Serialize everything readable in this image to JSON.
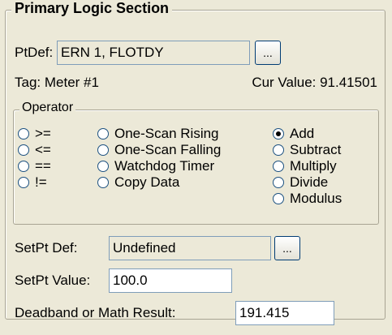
{
  "section": {
    "title": "Primary Logic Section"
  },
  "ptdef": {
    "label": "PtDef:",
    "value": "ERN 1, FLOTDY",
    "browse_label": "..."
  },
  "tag": {
    "label": "Tag: Meter #1",
    "cur_value": "Cur Value: 91.41501"
  },
  "operator": {
    "title": "Operator",
    "comparisons": [
      {
        "label": ">=",
        "selected": false
      },
      {
        "label": "<=",
        "selected": false
      },
      {
        "label": "==",
        "selected": false
      },
      {
        "label": "!=",
        "selected": false
      }
    ],
    "functions": [
      {
        "label": "One-Scan Rising",
        "selected": false
      },
      {
        "label": "One-Scan Falling",
        "selected": false
      },
      {
        "label": "Watchdog Timer",
        "selected": false
      },
      {
        "label": "Copy Data",
        "selected": false
      }
    ],
    "math": [
      {
        "label": "Add",
        "selected": true
      },
      {
        "label": "Subtract",
        "selected": false
      },
      {
        "label": "Multiply",
        "selected": false
      },
      {
        "label": "Divide",
        "selected": false
      },
      {
        "label": "Modulus",
        "selected": false
      }
    ]
  },
  "setpt_def": {
    "label": "SetPt Def:",
    "value": "Undefined",
    "browse_label": "..."
  },
  "setpt_value": {
    "label": "SetPt Value:",
    "value": "100.0"
  },
  "deadband": {
    "label": "Deadband or Math Result:",
    "value": "191.415"
  }
}
